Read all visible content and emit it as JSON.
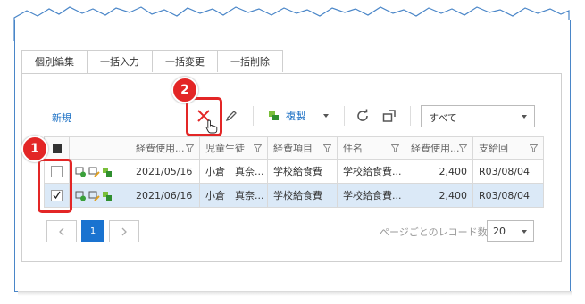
{
  "tabs": [
    {
      "label": "個別編集",
      "active": true
    },
    {
      "label": "一括入力",
      "active": false
    },
    {
      "label": "一括変更",
      "active": false
    },
    {
      "label": "一括削除",
      "active": false
    }
  ],
  "toolbar": {
    "new_label": "新規",
    "delete_tooltip": "削除",
    "copy_label": "複製",
    "filter_select_value": "すべて"
  },
  "grid": {
    "headers": [
      "経費使用...",
      "児童生徒",
      "経費項目",
      "件名",
      "経費使用...",
      "支給回"
    ],
    "rows": [
      {
        "selected": false,
        "cells": [
          "2021/05/16",
          "小倉　真奈...",
          "学校給食費",
          "学校給食費...",
          "2,400",
          "R03/08/04"
        ]
      },
      {
        "selected": true,
        "cells": [
          "2021/06/16",
          "小倉　真奈...",
          "学校給食費",
          "学校給食費...",
          "2,400",
          "R03/08/04"
        ]
      }
    ]
  },
  "pager": {
    "current_page": "1",
    "per_page_label": "ページごとのレコード数",
    "per_page_value": "20"
  },
  "annotations": [
    {
      "number": "1"
    },
    {
      "number": "2"
    }
  ],
  "colors": {
    "accent": "#1a73d0",
    "highlight": "#e32626",
    "selected_row": "#dbe9f7"
  }
}
